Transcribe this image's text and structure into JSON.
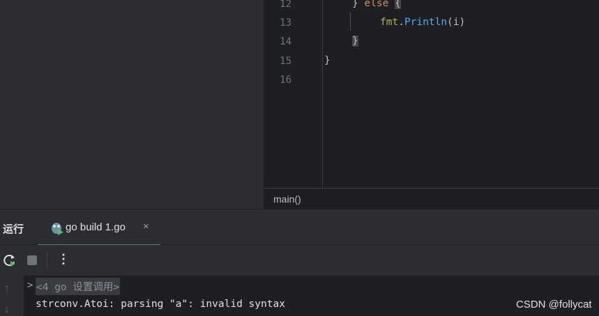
{
  "editor": {
    "line_numbers": [
      "12",
      "13",
      "14",
      "15",
      "16"
    ],
    "line12": {
      "close_brace": "}",
      "else_kw": "else",
      "open_brace": "{"
    },
    "line13": {
      "pkg": "fmt",
      "dot": ".",
      "func": "Println",
      "args": "(i)"
    },
    "line14": {
      "brace": "}"
    },
    "line15": {
      "brace": "}"
    },
    "breadcrumb": "main()"
  },
  "run_panel": {
    "title": "运行",
    "tab_label": "go build 1.go",
    "tab_close": "×",
    "more_label": "⋮",
    "folded_text": "<4 go 设置调用>",
    "fold_caret": ">",
    "error_text": "strconv.Atoi: parsing \"a\": invalid syntax"
  },
  "watermark": "CSDN @follycat",
  "icons": {
    "rerun": "rerun-icon",
    "stop": "stop-icon",
    "gopher": "gopher-run-icon",
    "scroll_up": "arrow-up-icon",
    "scroll_down": "arrow-down-icon"
  }
}
